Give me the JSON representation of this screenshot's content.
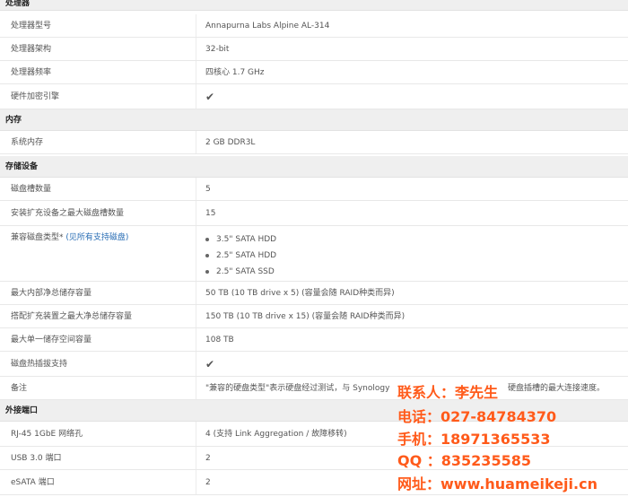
{
  "sections": {
    "processor": "处理器",
    "memory": "内存",
    "storage": "存储设备",
    "ports": "外接端口"
  },
  "rows": {
    "cpu_model": {
      "label": "处理器型号",
      "value": "Annapurna Labs Alpine AL-314"
    },
    "cpu_arch": {
      "label": "处理器架构",
      "value": "32-bit"
    },
    "cpu_freq": {
      "label": "处理器频率",
      "value": "四核心 1.7 GHz"
    },
    "hw_encrypt": {
      "label": "硬件加密引擎",
      "icon": "check-icon"
    },
    "system_memory": {
      "label": "系统内存",
      "value": "2 GB DDR3L"
    },
    "bays": {
      "label": "磁盘槽数量",
      "value": "5"
    },
    "max_bays": {
      "label": "安装扩充设备之最大磁盘槽数量",
      "value": "15"
    },
    "compat_drive": {
      "label": "兼容磁盘类型*",
      "link": "(见所有支持磁盘)",
      "items": [
        "3.5\" SATA HDD",
        "2.5\" SATA HDD",
        "2.5\" SATA SSD"
      ]
    },
    "max_internal": {
      "label": "最大内部净总储存容量",
      "value": "50 TB (10 TB drive x 5) (容量会随 RAID种类而异)"
    },
    "max_expansion": {
      "label": "搭配扩充装置之最大净总储存容量",
      "value": "150 TB (10 TB drive x 15) (容量会随 RAID种类而异)"
    },
    "max_volume": {
      "label": "最大单一储存空间容量",
      "value": "108 TB"
    },
    "hot_swap": {
      "label": "磁盘热插拔支持",
      "icon": "check-icon"
    },
    "notes": {
      "label": "备注",
      "value": "\"兼容的硬盘类型\"表示硬盘经过测试，与 Synology"
    },
    "notes_tail": {
      "value": "硬盘插槽的最大连接速度。"
    },
    "rj45": {
      "label": "RJ-45 1GbE 网络孔",
      "value": "4 (支持 Link Aggregation / 故障移转)"
    },
    "usb": {
      "label": "USB 3.0 端口",
      "value": "2"
    },
    "esata": {
      "label": "eSATA 端口",
      "value": "2"
    }
  },
  "watermark": {
    "contact": "联系人：李先生",
    "phone": "电话：027-84784370",
    "mobile": "手机：18971365533",
    "qq": "QQ ：835235585",
    "web": "网址：www.huameikeji.cn"
  },
  "colors": {
    "check": "#2f9b2f",
    "link": "#2a6eb5",
    "watermark": "#ff5a1a",
    "section_bg": "#efefef"
  }
}
